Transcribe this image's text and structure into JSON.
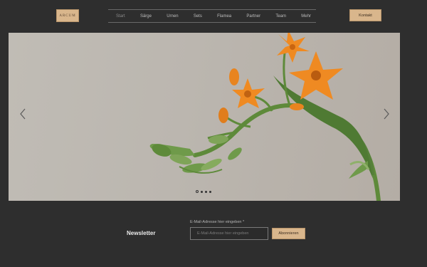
{
  "header": {
    "logo_text": "ARCUM",
    "nav": [
      {
        "label": "Start"
      },
      {
        "label": "Särge"
      },
      {
        "label": "Urnen"
      },
      {
        "label": "Sets"
      },
      {
        "label": "Flamea"
      },
      {
        "label": "Partner"
      },
      {
        "label": "Team"
      },
      {
        "label": "Mehr"
      }
    ],
    "active_nav": "Start",
    "contact_label": "Kontakt"
  },
  "slider": {
    "image_subject": "orange star-of-bethlehem flower",
    "prev_icon": "chevron-left-icon",
    "next_icon": "chevron-right-icon",
    "slide_count": 4,
    "active_slide": 1
  },
  "newsletter": {
    "title": "Newsletter",
    "email_label": "E-Mail-Adresse hier eingeben *",
    "email_placeholder": "E-Mail-Adresse hier eingeben",
    "submit_label": "Abonnieren"
  },
  "colors": {
    "background": "#2e2e2e",
    "accent": "#d9b68c",
    "petal": "#ef8a22",
    "stem": "#5e8a3a"
  }
}
